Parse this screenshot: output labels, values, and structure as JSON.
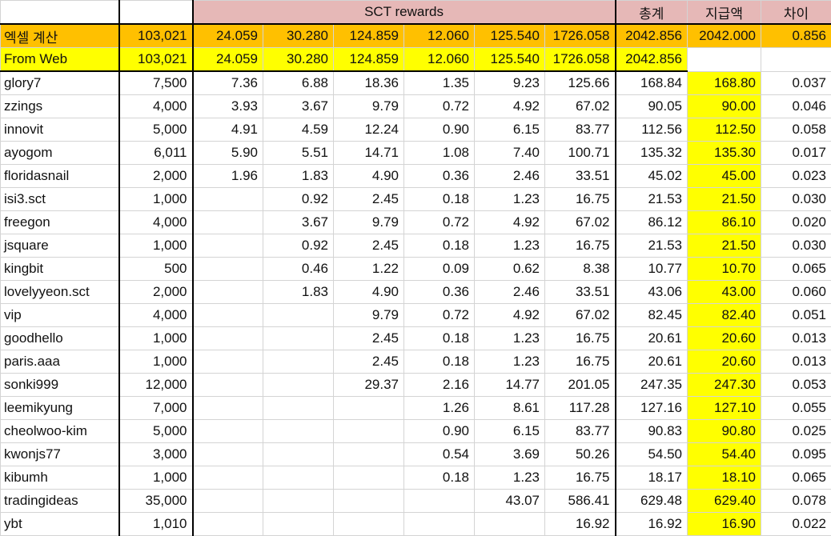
{
  "header": {
    "group_label": "SCT rewards",
    "total_label": "총계",
    "paid_label": "지급액",
    "diff_label": "차이"
  },
  "summary_rows": [
    {
      "name": "엑셀 계산",
      "amount": "103,021",
      "r": [
        "24.059",
        "30.280",
        "124.859",
        "12.060",
        "125.540",
        "1726.058"
      ],
      "total": "2042.856",
      "paid": "2042.000",
      "diff": "0.856"
    },
    {
      "name": "From Web",
      "amount": "103,021",
      "r": [
        "24.059",
        "30.280",
        "124.859",
        "12.060",
        "125.540",
        "1726.058"
      ],
      "total": "2042.856",
      "paid": "",
      "diff": ""
    }
  ],
  "rows": [
    {
      "name": "glory7",
      "amount": "7,500",
      "r": [
        "7.36",
        "6.88",
        "18.36",
        "1.35",
        "9.23",
        "125.66"
      ],
      "total": "168.84",
      "paid": "168.80",
      "diff": "0.037"
    },
    {
      "name": "zzings",
      "amount": "4,000",
      "r": [
        "3.93",
        "3.67",
        "9.79",
        "0.72",
        "4.92",
        "67.02"
      ],
      "total": "90.05",
      "paid": "90.00",
      "diff": "0.046"
    },
    {
      "name": "innovit",
      "amount": "5,000",
      "r": [
        "4.91",
        "4.59",
        "12.24",
        "0.90",
        "6.15",
        "83.77"
      ],
      "total": "112.56",
      "paid": "112.50",
      "diff": "0.058"
    },
    {
      "name": "ayogom",
      "amount": "6,011",
      "r": [
        "5.90",
        "5.51",
        "14.71",
        "1.08",
        "7.40",
        "100.71"
      ],
      "total": "135.32",
      "paid": "135.30",
      "diff": "0.017"
    },
    {
      "name": "floridasnail",
      "amount": "2,000",
      "r": [
        "1.96",
        "1.83",
        "4.90",
        "0.36",
        "2.46",
        "33.51"
      ],
      "total": "45.02",
      "paid": "45.00",
      "diff": "0.023"
    },
    {
      "name": "isi3.sct",
      "amount": "1,000",
      "r": [
        "",
        "0.92",
        "2.45",
        "0.18",
        "1.23",
        "16.75"
      ],
      "total": "21.53",
      "paid": "21.50",
      "diff": "0.030"
    },
    {
      "name": "freegon",
      "amount": "4,000",
      "r": [
        "",
        "3.67",
        "9.79",
        "0.72",
        "4.92",
        "67.02"
      ],
      "total": "86.12",
      "paid": "86.10",
      "diff": "0.020"
    },
    {
      "name": "jsquare",
      "amount": "1,000",
      "r": [
        "",
        "0.92",
        "2.45",
        "0.18",
        "1.23",
        "16.75"
      ],
      "total": "21.53",
      "paid": "21.50",
      "diff": "0.030"
    },
    {
      "name": "kingbit",
      "amount": "500",
      "r": [
        "",
        "0.46",
        "1.22",
        "0.09",
        "0.62",
        "8.38"
      ],
      "total": "10.77",
      "paid": "10.70",
      "diff": "0.065"
    },
    {
      "name": "lovelyyeon.sct",
      "amount": "2,000",
      "r": [
        "",
        "1.83",
        "4.90",
        "0.36",
        "2.46",
        "33.51"
      ],
      "total": "43.06",
      "paid": "43.00",
      "diff": "0.060"
    },
    {
      "name": "vip",
      "amount": "4,000",
      "r": [
        "",
        "",
        "9.79",
        "0.72",
        "4.92",
        "67.02"
      ],
      "total": "82.45",
      "paid": "82.40",
      "diff": "0.051"
    },
    {
      "name": "goodhello",
      "amount": "1,000",
      "r": [
        "",
        "",
        "2.45",
        "0.18",
        "1.23",
        "16.75"
      ],
      "total": "20.61",
      "paid": "20.60",
      "diff": "0.013"
    },
    {
      "name": "paris.aaa",
      "amount": "1,000",
      "r": [
        "",
        "",
        "2.45",
        "0.18",
        "1.23",
        "16.75"
      ],
      "total": "20.61",
      "paid": "20.60",
      "diff": "0.013"
    },
    {
      "name": "sonki999",
      "amount": "12,000",
      "r": [
        "",
        "",
        "29.37",
        "2.16",
        "14.77",
        "201.05"
      ],
      "total": "247.35",
      "paid": "247.30",
      "diff": "0.053"
    },
    {
      "name": "leemikyung",
      "amount": "7,000",
      "r": [
        "",
        "",
        "",
        "1.26",
        "8.61",
        "117.28"
      ],
      "total": "127.16",
      "paid": "127.10",
      "diff": "0.055"
    },
    {
      "name": "cheolwoo-kim",
      "amount": "5,000",
      "r": [
        "",
        "",
        "",
        "0.90",
        "6.15",
        "83.77"
      ],
      "total": "90.83",
      "paid": "90.80",
      "diff": "0.025"
    },
    {
      "name": "kwonjs77",
      "amount": "3,000",
      "r": [
        "",
        "",
        "",
        "0.54",
        "3.69",
        "50.26"
      ],
      "total": "54.50",
      "paid": "54.40",
      "diff": "0.095"
    },
    {
      "name": "kibumh",
      "amount": "1,000",
      "r": [
        "",
        "",
        "",
        "0.18",
        "1.23",
        "16.75"
      ],
      "total": "18.17",
      "paid": "18.10",
      "diff": "0.065"
    },
    {
      "name": "tradingideas",
      "amount": "35,000",
      "r": [
        "",
        "",
        "",
        "",
        "43.07",
        "586.41"
      ],
      "total": "629.48",
      "paid": "629.40",
      "diff": "0.078"
    },
    {
      "name": "ybt",
      "amount": "1,010",
      "r": [
        "",
        "",
        "",
        "",
        "",
        "16.92"
      ],
      "total": "16.92",
      "paid": "16.90",
      "diff": "0.022"
    }
  ]
}
